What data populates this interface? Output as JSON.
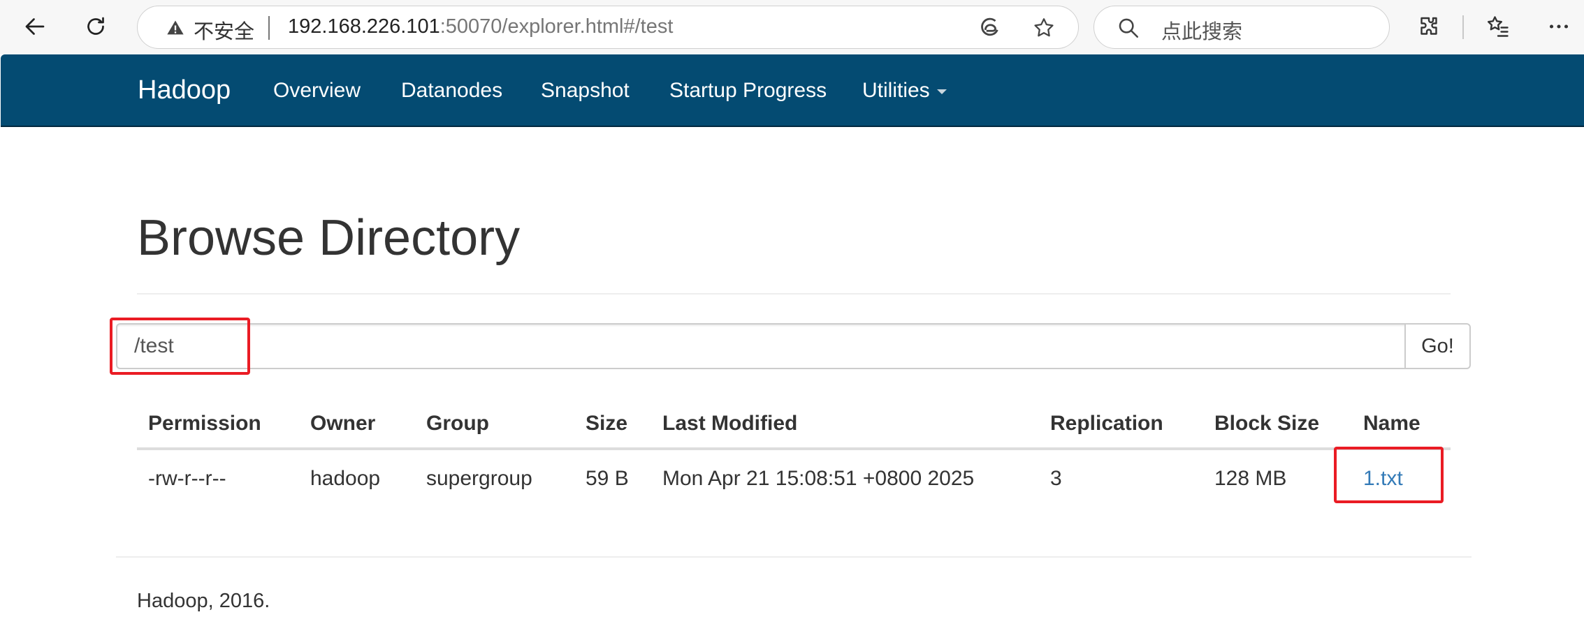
{
  "browser": {
    "security_label": "不安全",
    "url_host": "192.168.226.101",
    "url_rest": ":50070/explorer.html#/test",
    "search_placeholder": "点此搜索"
  },
  "navbar": {
    "brand": "Hadoop",
    "items": [
      {
        "label": "Overview"
      },
      {
        "label": "Datanodes"
      },
      {
        "label": "Snapshot"
      },
      {
        "label": "Startup Progress"
      },
      {
        "label": "Utilities"
      }
    ]
  },
  "page": {
    "title": "Browse Directory",
    "path_value": "/test",
    "go_label": "Go!"
  },
  "table": {
    "columns": [
      "Permission",
      "Owner",
      "Group",
      "Size",
      "Last Modified",
      "Replication",
      "Block Size",
      "Name"
    ],
    "rows": [
      {
        "permission": "-rw-r--r--",
        "owner": "hadoop",
        "group": "supergroup",
        "size": "59 B",
        "last_modified": "Mon Apr 21 15:08:51 +0800 2025",
        "replication": "3",
        "block_size": "128 MB",
        "name": "1.txt"
      }
    ]
  },
  "footer": {
    "text": "Hadoop, 2016."
  },
  "colors": {
    "navbar": "#044b72",
    "link": "#337ab7",
    "highlight": "#ea1c24"
  }
}
